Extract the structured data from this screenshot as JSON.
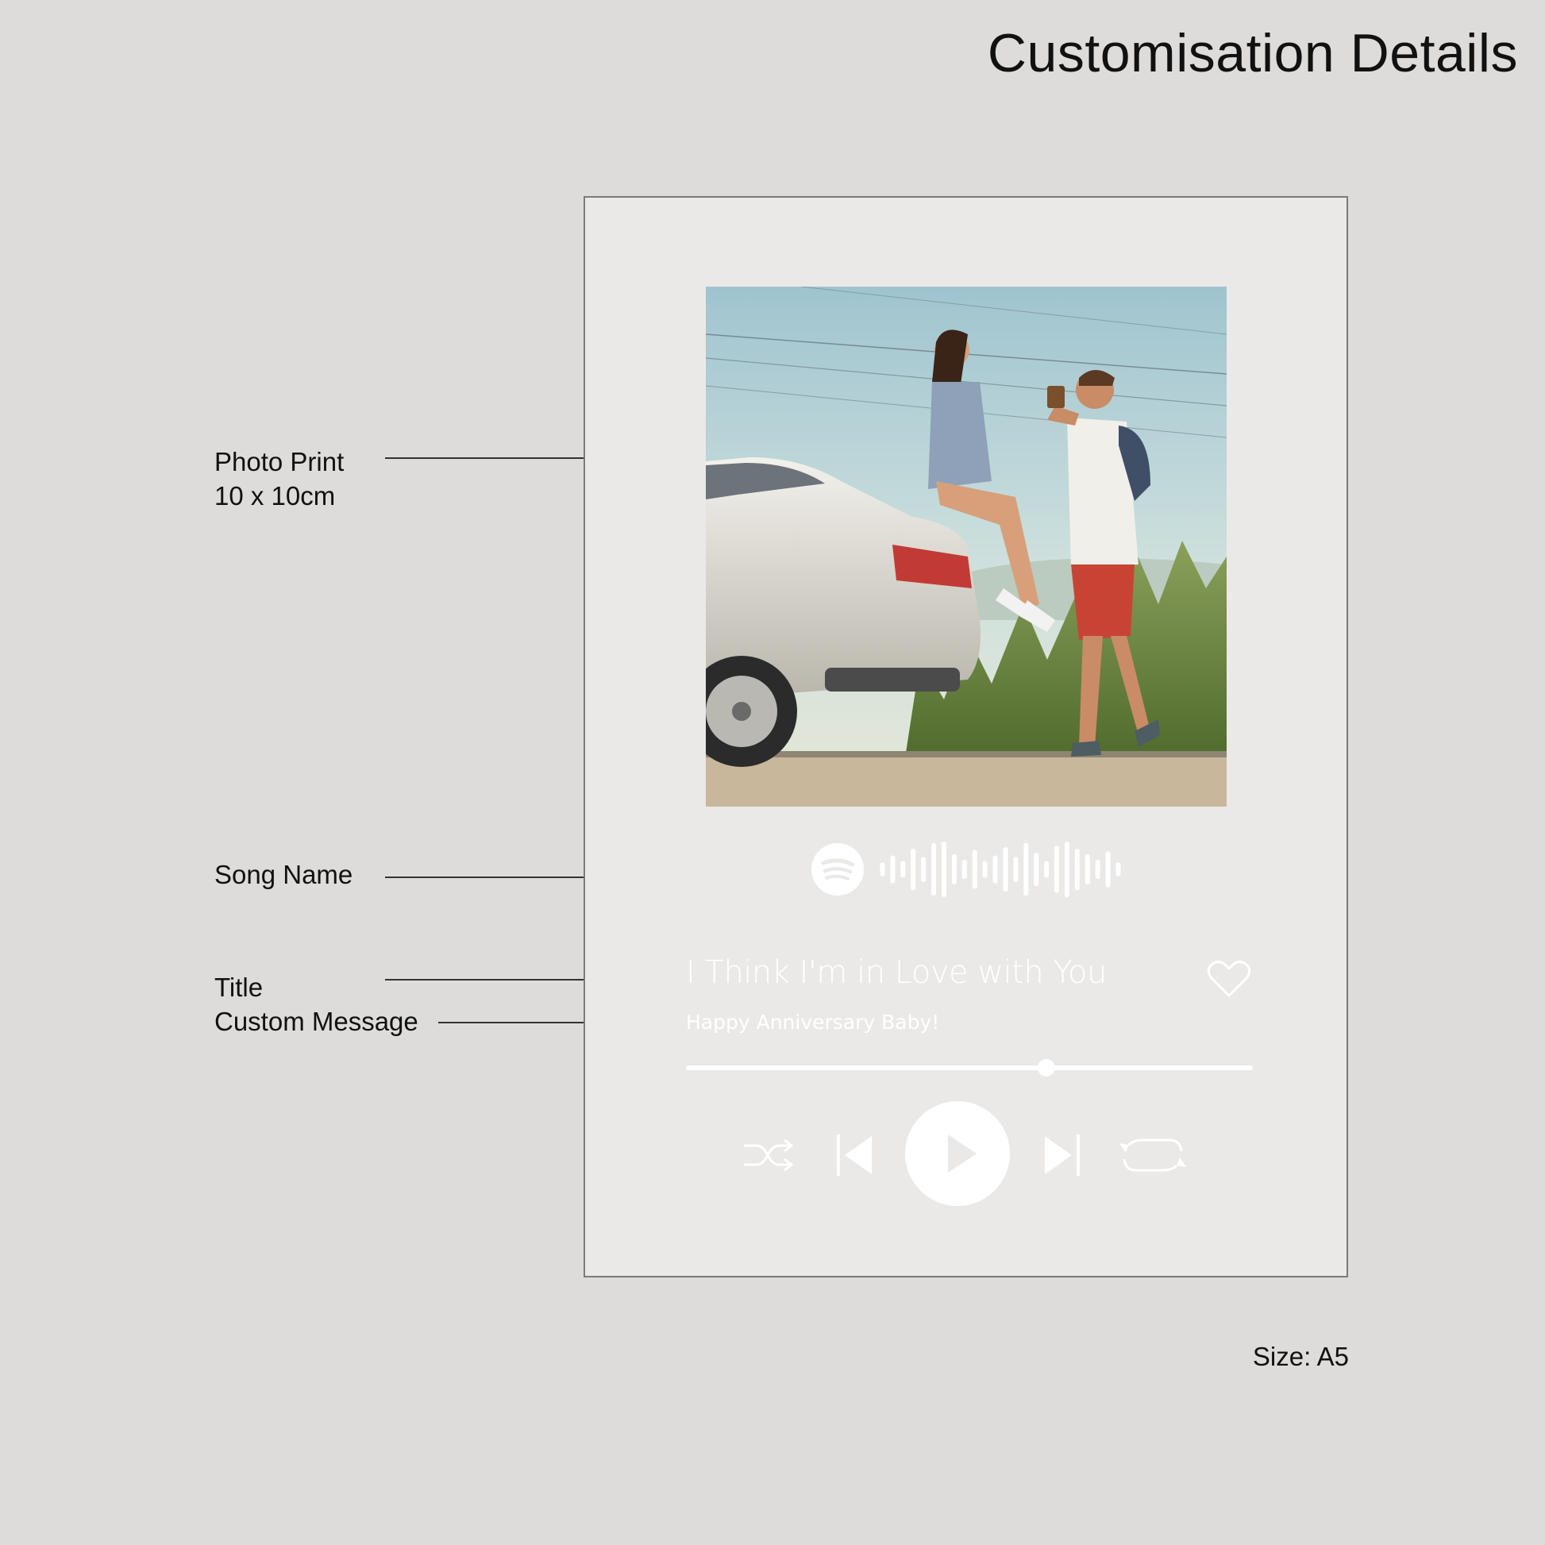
{
  "page_title": "Customisation Details",
  "callouts": {
    "photo_print": {
      "line1": "Photo Print",
      "line2": "10 x 10cm"
    },
    "song_name": "Song Name",
    "title": "Title",
    "custom_message": "Custom Message"
  },
  "plaque": {
    "song_title": "I Think I'm in Love with You",
    "custom_message": "Happy Anniversary Baby!",
    "progress": 0.64,
    "icons": {
      "scan_code": "spotify-logo-icon",
      "like": "heart-icon",
      "controls": [
        "shuffle-icon",
        "previous-icon",
        "play-icon",
        "next-icon",
        "repeat-icon"
      ]
    }
  },
  "size_label": "Size: A5",
  "colors": {
    "background": "#dedcda",
    "plaque": "#ebe9e7",
    "plaque_border": "#7d7b79",
    "player_elements": "#ffffff"
  }
}
